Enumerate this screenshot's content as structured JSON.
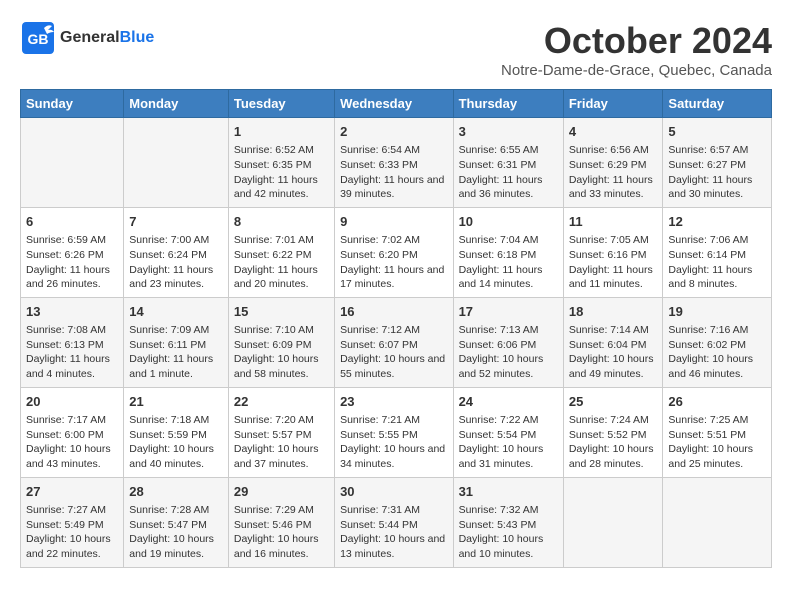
{
  "header": {
    "logo_general": "General",
    "logo_blue": "Blue",
    "title": "October 2024",
    "subtitle": "Notre-Dame-de-Grace, Quebec, Canada"
  },
  "days_of_week": [
    "Sunday",
    "Monday",
    "Tuesday",
    "Wednesday",
    "Thursday",
    "Friday",
    "Saturday"
  ],
  "weeks": [
    [
      {
        "day": "",
        "info": ""
      },
      {
        "day": "",
        "info": ""
      },
      {
        "day": "1",
        "info": "Sunrise: 6:52 AM\nSunset: 6:35 PM\nDaylight: 11 hours and 42 minutes."
      },
      {
        "day": "2",
        "info": "Sunrise: 6:54 AM\nSunset: 6:33 PM\nDaylight: 11 hours and 39 minutes."
      },
      {
        "day": "3",
        "info": "Sunrise: 6:55 AM\nSunset: 6:31 PM\nDaylight: 11 hours and 36 minutes."
      },
      {
        "day": "4",
        "info": "Sunrise: 6:56 AM\nSunset: 6:29 PM\nDaylight: 11 hours and 33 minutes."
      },
      {
        "day": "5",
        "info": "Sunrise: 6:57 AM\nSunset: 6:27 PM\nDaylight: 11 hours and 30 minutes."
      }
    ],
    [
      {
        "day": "6",
        "info": "Sunrise: 6:59 AM\nSunset: 6:26 PM\nDaylight: 11 hours and 26 minutes."
      },
      {
        "day": "7",
        "info": "Sunrise: 7:00 AM\nSunset: 6:24 PM\nDaylight: 11 hours and 23 minutes."
      },
      {
        "day": "8",
        "info": "Sunrise: 7:01 AM\nSunset: 6:22 PM\nDaylight: 11 hours and 20 minutes."
      },
      {
        "day": "9",
        "info": "Sunrise: 7:02 AM\nSunset: 6:20 PM\nDaylight: 11 hours and 17 minutes."
      },
      {
        "day": "10",
        "info": "Sunrise: 7:04 AM\nSunset: 6:18 PM\nDaylight: 11 hours and 14 minutes."
      },
      {
        "day": "11",
        "info": "Sunrise: 7:05 AM\nSunset: 6:16 PM\nDaylight: 11 hours and 11 minutes."
      },
      {
        "day": "12",
        "info": "Sunrise: 7:06 AM\nSunset: 6:14 PM\nDaylight: 11 hours and 8 minutes."
      }
    ],
    [
      {
        "day": "13",
        "info": "Sunrise: 7:08 AM\nSunset: 6:13 PM\nDaylight: 11 hours and 4 minutes."
      },
      {
        "day": "14",
        "info": "Sunrise: 7:09 AM\nSunset: 6:11 PM\nDaylight: 11 hours and 1 minute."
      },
      {
        "day": "15",
        "info": "Sunrise: 7:10 AM\nSunset: 6:09 PM\nDaylight: 10 hours and 58 minutes."
      },
      {
        "day": "16",
        "info": "Sunrise: 7:12 AM\nSunset: 6:07 PM\nDaylight: 10 hours and 55 minutes."
      },
      {
        "day": "17",
        "info": "Sunrise: 7:13 AM\nSunset: 6:06 PM\nDaylight: 10 hours and 52 minutes."
      },
      {
        "day": "18",
        "info": "Sunrise: 7:14 AM\nSunset: 6:04 PM\nDaylight: 10 hours and 49 minutes."
      },
      {
        "day": "19",
        "info": "Sunrise: 7:16 AM\nSunset: 6:02 PM\nDaylight: 10 hours and 46 minutes."
      }
    ],
    [
      {
        "day": "20",
        "info": "Sunrise: 7:17 AM\nSunset: 6:00 PM\nDaylight: 10 hours and 43 minutes."
      },
      {
        "day": "21",
        "info": "Sunrise: 7:18 AM\nSunset: 5:59 PM\nDaylight: 10 hours and 40 minutes."
      },
      {
        "day": "22",
        "info": "Sunrise: 7:20 AM\nSunset: 5:57 PM\nDaylight: 10 hours and 37 minutes."
      },
      {
        "day": "23",
        "info": "Sunrise: 7:21 AM\nSunset: 5:55 PM\nDaylight: 10 hours and 34 minutes."
      },
      {
        "day": "24",
        "info": "Sunrise: 7:22 AM\nSunset: 5:54 PM\nDaylight: 10 hours and 31 minutes."
      },
      {
        "day": "25",
        "info": "Sunrise: 7:24 AM\nSunset: 5:52 PM\nDaylight: 10 hours and 28 minutes."
      },
      {
        "day": "26",
        "info": "Sunrise: 7:25 AM\nSunset: 5:51 PM\nDaylight: 10 hours and 25 minutes."
      }
    ],
    [
      {
        "day": "27",
        "info": "Sunrise: 7:27 AM\nSunset: 5:49 PM\nDaylight: 10 hours and 22 minutes."
      },
      {
        "day": "28",
        "info": "Sunrise: 7:28 AM\nSunset: 5:47 PM\nDaylight: 10 hours and 19 minutes."
      },
      {
        "day": "29",
        "info": "Sunrise: 7:29 AM\nSunset: 5:46 PM\nDaylight: 10 hours and 16 minutes."
      },
      {
        "day": "30",
        "info": "Sunrise: 7:31 AM\nSunset: 5:44 PM\nDaylight: 10 hours and 13 minutes."
      },
      {
        "day": "31",
        "info": "Sunrise: 7:32 AM\nSunset: 5:43 PM\nDaylight: 10 hours and 10 minutes."
      },
      {
        "day": "",
        "info": ""
      },
      {
        "day": "",
        "info": ""
      }
    ]
  ]
}
